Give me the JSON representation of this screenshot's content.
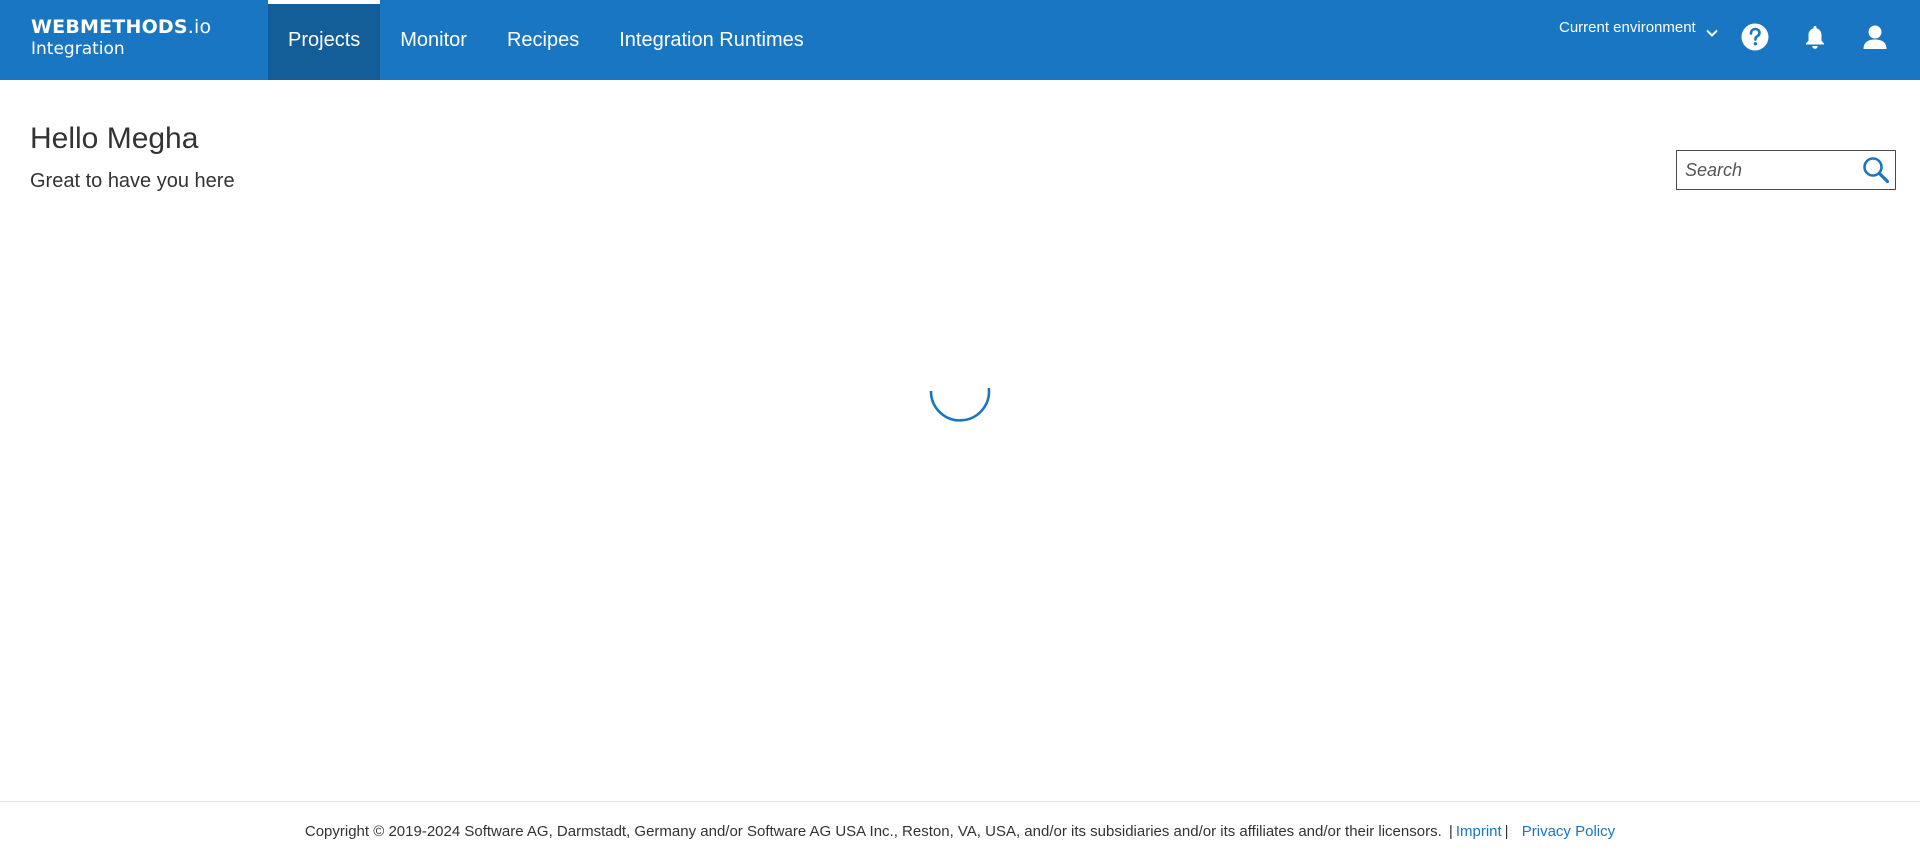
{
  "brand": {
    "name_bold": "WEBMETHODS",
    "name_suffix": ".io",
    "sub": "Integration"
  },
  "nav": {
    "tabs": [
      {
        "label": "Projects",
        "active": true
      },
      {
        "label": "Monitor",
        "active": false
      },
      {
        "label": "Recipes",
        "active": false
      },
      {
        "label": "Integration Runtimes",
        "active": false
      }
    ]
  },
  "header": {
    "environment_label": "Current environment",
    "icons": [
      "help-icon",
      "bell-icon",
      "user-icon"
    ]
  },
  "main": {
    "greeting": "Hello Megha",
    "subgreeting": "Great to have you here",
    "search_placeholder": "Search",
    "loading": true
  },
  "footer": {
    "copyright": "Copyright © 2019-2024 Software AG, Darmstadt, Germany and/or Software AG USA Inc., Reston, VA, USA, and/or its subsidiaries and/or its affiliates and/or their licensors.",
    "separator": "|",
    "imprint": "Imprint",
    "privacy": "Privacy Policy"
  },
  "colors": {
    "accent": "#1976c2",
    "active_tab": "#135d98"
  }
}
